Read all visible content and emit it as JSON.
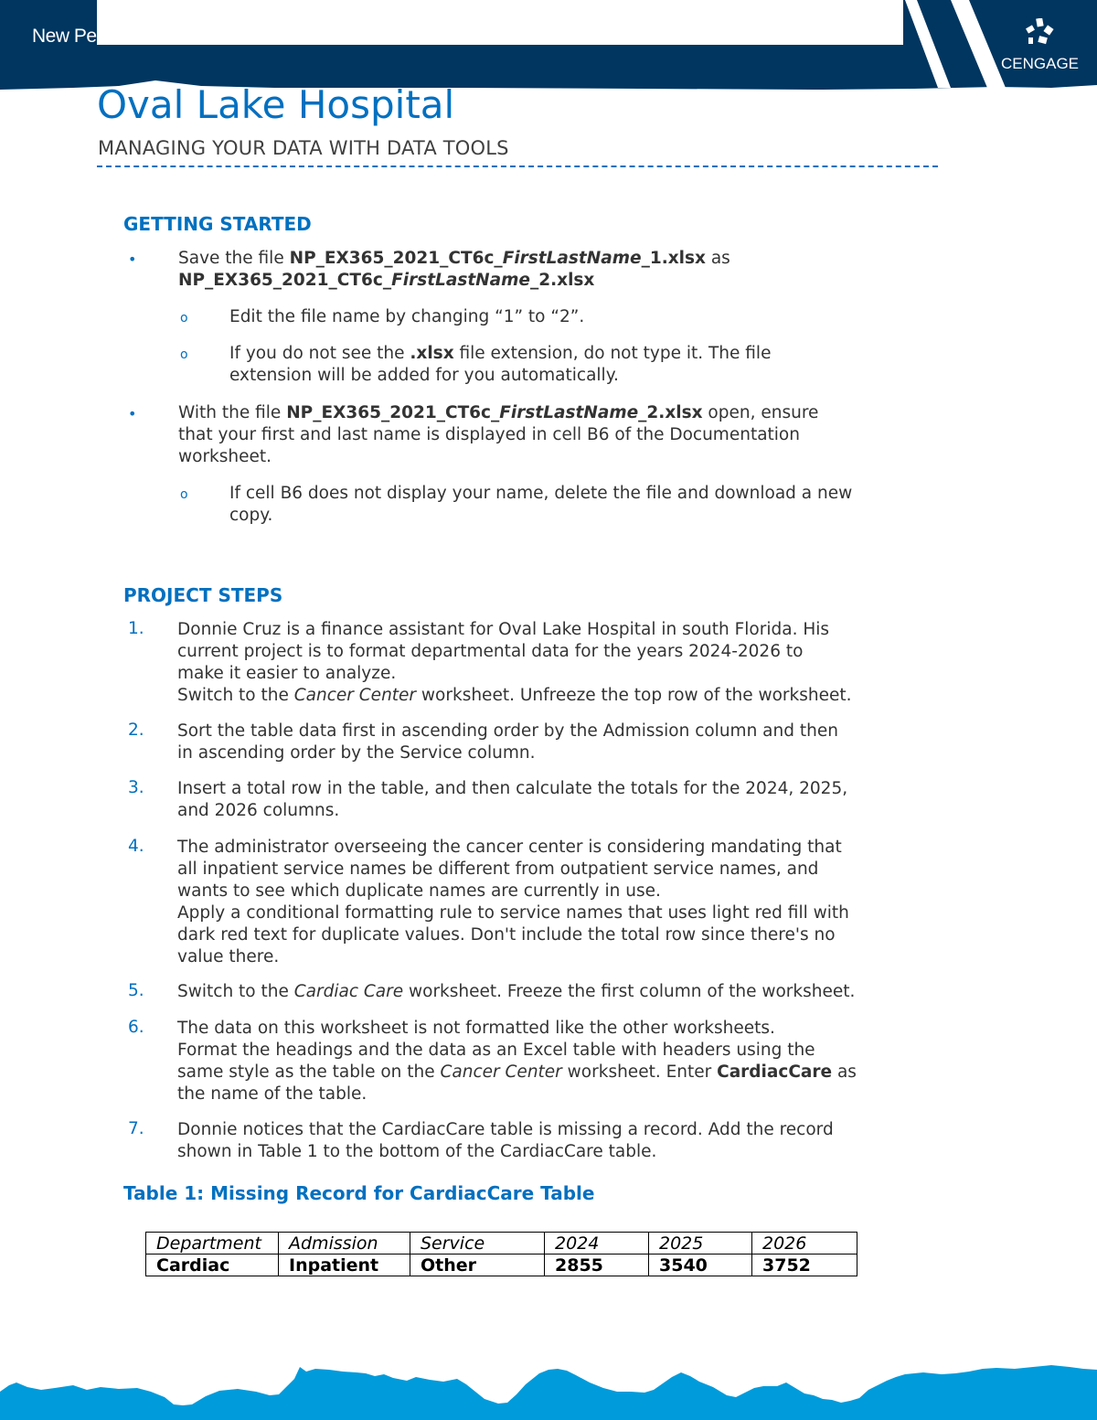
{
  "header": {
    "series_text": "New Pe",
    "brand": "CENGAGE",
    "colors": {
      "band": "#003660",
      "accent": "#0070c0",
      "footer": "#009bdb"
    }
  },
  "document": {
    "title": "Oval Lake Hospital",
    "subtitle": "MANAGING YOUR DATA WITH DATA TOOLS"
  },
  "getting_started": {
    "heading": "GETTING STARTED",
    "b1": {
      "t1": "Save the file ",
      "f1a": "NP_EX365_2021_CT6c_",
      "f1b": "FirstLastName",
      "f1c": "_1.xlsx",
      "t2": " as",
      "f2a": "NP_EX365_2021_CT6c_",
      "f2b": "FirstLastName",
      "f2c": "_2.xlsx",
      "sub1": "Edit the file name by changing “1” to “2”.",
      "sub2a": "If you do not see the ",
      "sub2b": ".xlsx",
      "sub2c": " file extension, do not type it. The file",
      "sub2d": "extension will be added for you automatically."
    },
    "b2": {
      "t1": "With the file ",
      "fa": "NP_EX365_2021_CT6c_",
      "fb": "FirstLastName",
      "fc": "_2.xlsx",
      "t2": " open, ensure",
      "line2": "that your first and last name is displayed in cell B6 of the Documentation",
      "line3": "worksheet.",
      "sub1a": "If cell B6 does not display your name, delete the file and download a new",
      "sub1b": "copy."
    },
    "bullet_glyph": "•",
    "sub_bullet_glyph": "o"
  },
  "project_steps": {
    "heading": "PROJECT STEPS",
    "steps": [
      {
        "num": "1.",
        "l1": "Donnie Cruz is a finance assistant for Oval Lake Hospital in south Florida. His",
        "l2": "current project is to format departmental data for the years 2024-2026 to",
        "l3": "make it easier to analyze.",
        "l4a": "Switch to the ",
        "l4b": "Cancer Center",
        "l4c": " worksheet. Unfreeze the top row of the worksheet."
      },
      {
        "num": "2.",
        "l1": "Sort the table data first in ascending order by the Admission column and then",
        "l2": "in ascending order by the Service column."
      },
      {
        "num": "3.",
        "l1": "Insert a total row in the table, and then calculate the totals for the 2024, 2025,",
        "l2": "and 2026 columns."
      },
      {
        "num": "4.",
        "l1": "The administrator overseeing the cancer center is considering mandating that",
        "l2": "all inpatient service names be different from outpatient service names, and",
        "l3": "wants to see which duplicate names are currently in use.",
        "l4": "Apply a conditional formatting rule to service names that uses light red fill with",
        "l5": "dark red text for duplicate values. Don't include the total row since there's no",
        "l6": "value there."
      },
      {
        "num": "5.",
        "l1a": "Switch to the ",
        "l1b": "Cardiac Care",
        "l1c": " worksheet. Freeze the first column of the worksheet."
      },
      {
        "num": "6.",
        "l1": "The data on this worksheet is not formatted like the other worksheets.",
        "l2": "Format the headings and the data as an Excel table with headers using the",
        "l3a": "same style as the table on the ",
        "l3b": "Cancer Center",
        "l3c": " worksheet. Enter ",
        "l3d": "CardiacCare",
        "l3e": " as",
        "l4": "the name of the table."
      },
      {
        "num": "7.",
        "l1": "Donnie notices that the CardiacCare table is missing a record. Add the record",
        "l2": "shown in Table 1 to the bottom of the CardiacCare table."
      }
    ]
  },
  "table1": {
    "caption": "Table 1: Missing Record for CardiacCare Table",
    "headers": [
      "Department",
      "Admission",
      "Service",
      "2024",
      "2025",
      "2026"
    ],
    "row": [
      "Cardiac",
      "Inpatient",
      "Other",
      "2855",
      "3540",
      "3752"
    ]
  }
}
